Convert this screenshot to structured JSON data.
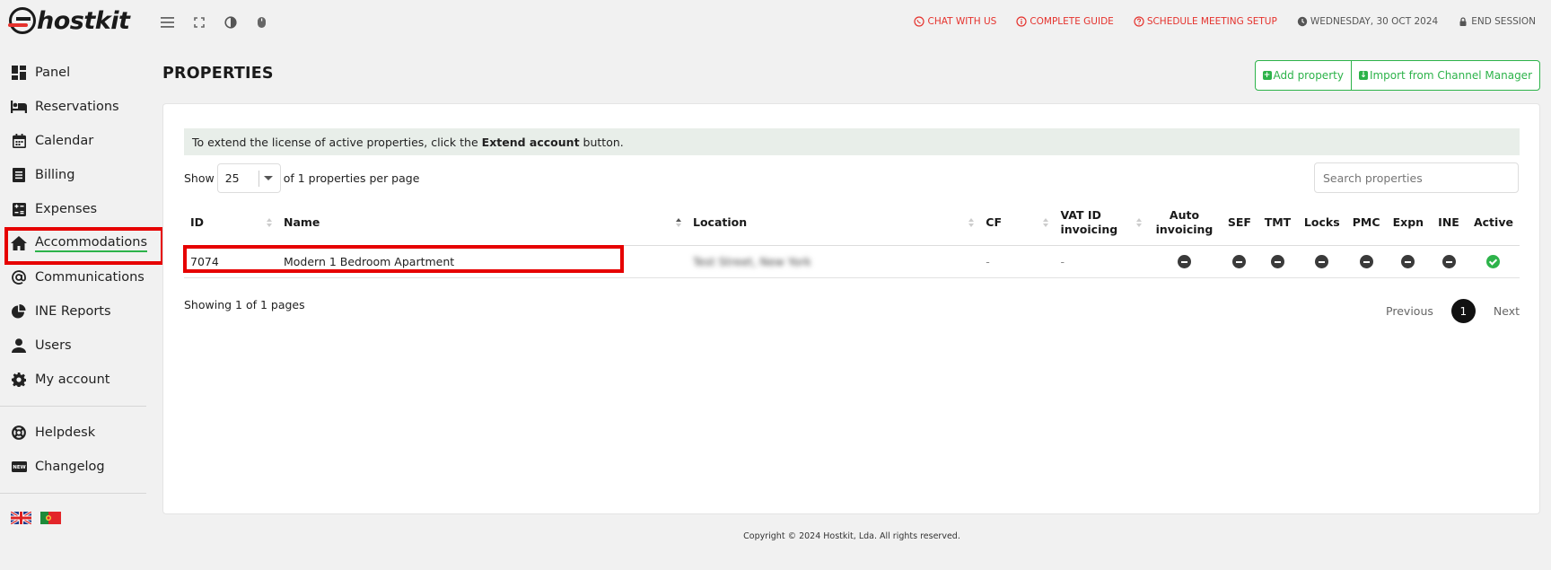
{
  "app": {
    "logo_text": "hostkit"
  },
  "topbar": {
    "links": [
      {
        "label": "CHAT WITH US",
        "icon": "whatsapp-icon"
      },
      {
        "label": "COMPLETE GUIDE",
        "icon": "info-icon"
      },
      {
        "label": "SCHEDULE MEETING SETUP",
        "icon": "help-icon"
      }
    ],
    "date": "WEDNESDAY, 30 OCT 2024",
    "end_session": "END SESSION"
  },
  "sidebar": {
    "items": [
      {
        "label": "Panel",
        "icon": "dashboard-icon"
      },
      {
        "label": "Reservations",
        "icon": "bed-icon"
      },
      {
        "label": "Calendar",
        "icon": "calendar-icon"
      },
      {
        "label": "Billing",
        "icon": "billing-icon"
      },
      {
        "label": "Expenses",
        "icon": "expenses-icon"
      },
      {
        "label": "Accommodations",
        "icon": "home-icon",
        "active": true
      },
      {
        "label": "Communications",
        "icon": "at-icon"
      },
      {
        "label": "INE Reports",
        "icon": "pie-chart-icon"
      },
      {
        "label": "Users",
        "icon": "user-icon"
      },
      {
        "label": "My account",
        "icon": "gear-icon"
      }
    ],
    "secondary": [
      {
        "label": "Helpdesk",
        "icon": "lifebuoy-icon"
      },
      {
        "label": "Changelog",
        "icon": "new-badge-icon"
      }
    ]
  },
  "page": {
    "title": "PROPERTIES",
    "add_property": "Add property",
    "import_channel": "Import from Channel Manager"
  },
  "notice": {
    "prefix": "To extend the license of active properties, click the",
    "bold": "Extend account",
    "suffix": "button."
  },
  "table_controls": {
    "show": "Show",
    "page_size": "25",
    "per_page": "of 1 properties per page",
    "search_placeholder": "Search properties"
  },
  "table": {
    "headers": [
      "ID",
      "Name",
      "Location",
      "CF",
      "VAT ID invoicing",
      "Auto invoicing",
      "SEF",
      "TMT",
      "Locks",
      "PMC",
      "Expn",
      "INE",
      "Active"
    ],
    "rows": [
      {
        "id": "7074",
        "name": "Modern 1 Bedroom Apartment",
        "location": "Test Street, New York",
        "cf": "-",
        "vat": "-",
        "flags": [
          "off",
          "off",
          "off",
          "off",
          "off",
          "off",
          "off"
        ],
        "active": "on"
      }
    ]
  },
  "pagination": {
    "showing": "Showing 1 of 1 pages",
    "previous": "Previous",
    "current": "1",
    "next": "Next"
  },
  "footer": {
    "copyright": "Copyright © 2024 Hostkit, Lda. All rights reserved."
  },
  "colors": {
    "accent_green": "#2db34a",
    "link_red": "#e5322d",
    "highlight_red": "#e60000"
  }
}
